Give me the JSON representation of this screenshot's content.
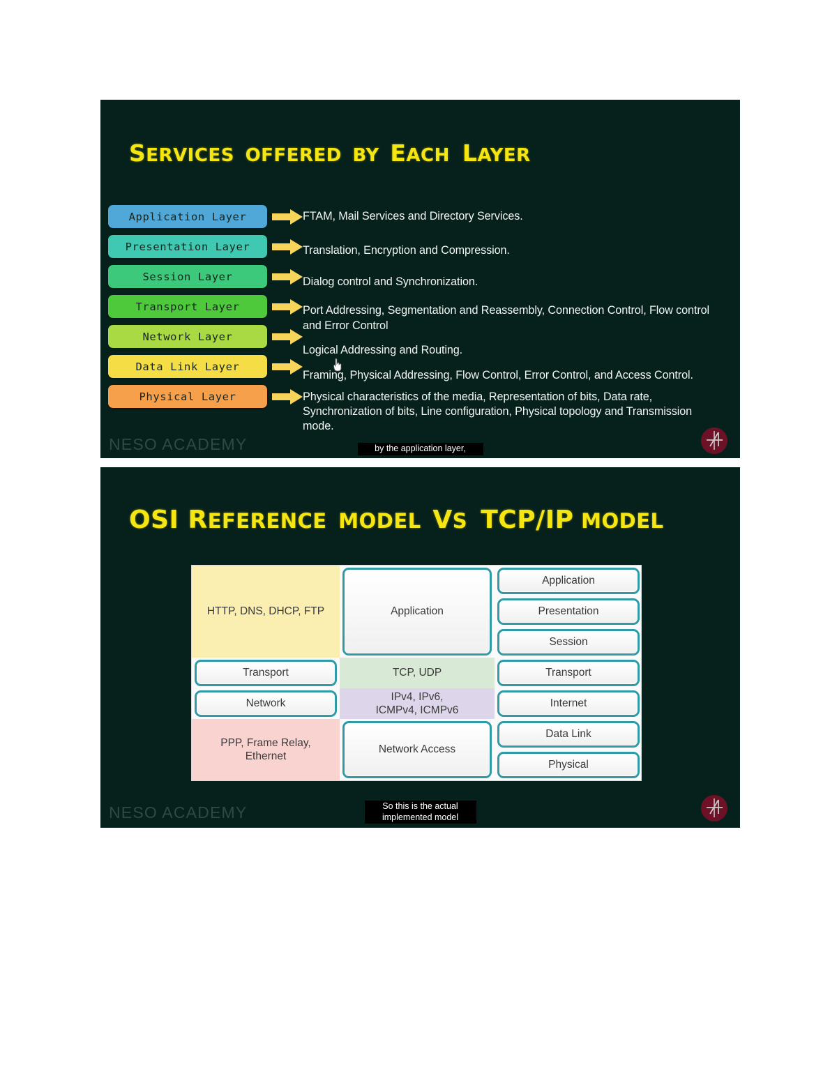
{
  "slides": [
    {
      "id": "services",
      "title_words": [
        {
          "cap": "S",
          "rest": "ERVICES"
        },
        {
          "cap": "",
          "rest": "OFFERED"
        },
        {
          "cap": "",
          "rest": "BY"
        },
        {
          "cap": "E",
          "rest": "ACH"
        },
        {
          "cap": "L",
          "rest": "AYER"
        }
      ],
      "title_plain": "SERVICES OFFERED BY EACH LAYER",
      "watermark": "NESO ACADEMY",
      "caption": "by the application layer,",
      "logo_name": "neso-academy-logo",
      "layers": [
        {
          "name": "Application Layer",
          "color": "#4fa8d8",
          "service": "FTAM, Mail Services and Directory Services."
        },
        {
          "name": "Presentation Layer",
          "color": "#3fc9b3",
          "service": "Translation, Encryption and Compression."
        },
        {
          "name": "Session Layer",
          "color": "#3cc97b",
          "service": "Dialog control and Synchronization."
        },
        {
          "name": "Transport Layer",
          "color": "#4ec93c",
          "service": "Port Addressing, Segmentation and Reassembly, Connection Control, Flow control and Error Control"
        },
        {
          "name": "Network Layer",
          "color": "#a9da44",
          "service": "Logical Addressing and Routing."
        },
        {
          "name": "Data Link Layer",
          "color": "#f5dd45",
          "service": "Framing, Physical Addressing, Flow Control, Error Control, and Access Control."
        },
        {
          "name": "Physical Layer",
          "color": "#f7a04c",
          "service": "Physical characteristics of the media, Representation of bits, Data rate, Synchronization of bits, Line configuration, Physical topology and Transmission mode."
        }
      ],
      "arrow_color": "#f7d55a"
    },
    {
      "id": "osi",
      "title_plain": "OSI REFERENCE MODEL VS TCP/IP MODEL",
      "watermark": "NESO ACADEMY",
      "caption": "So this is the actual\nimplemented model",
      "logo_name": "neso-academy-logo"
    }
  ],
  "osi_table": {
    "osi_layers": [
      "Application",
      "Presentation",
      "Session",
      "Transport",
      "Network",
      "Data Link",
      "Physical"
    ],
    "protocols": [
      {
        "text": "HTTP, DNS, DHCP, FTP",
        "span": 3,
        "color": "#faeeb0"
      },
      {
        "text": "TCP, UDP",
        "span": 1,
        "color": "#d8e9d6"
      },
      {
        "text": "IPv4, IPv6,\nICMPv4, ICMPv6",
        "span": 1,
        "color": "#ddd5ea"
      },
      {
        "text": "PPP, Frame Relay,\nEthernet",
        "span": 2,
        "color": "#f9d3d0"
      }
    ],
    "tcpip_layers": [
      {
        "text": "Application",
        "span": 3
      },
      {
        "text": "Transport",
        "span": 1
      },
      {
        "text": "Internet",
        "span": 1
      },
      {
        "text": "Network Access",
        "span": 2
      }
    ],
    "border_color": "#2f9ba6"
  },
  "cursors": [
    {
      "name": "pointer-cursor-1"
    },
    {
      "name": "pointer-cursor-2"
    }
  ]
}
